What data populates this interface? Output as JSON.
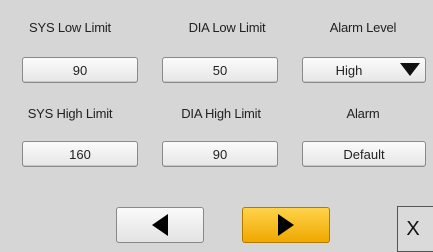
{
  "labels": {
    "sys_low": "SYS Low Limit",
    "dia_low": "DIA Low Limit",
    "alarm_level": "Alarm Level",
    "sys_high": "SYS High Limit",
    "dia_high": "DIA High Limit",
    "alarm": "Alarm"
  },
  "values": {
    "sys_low": "90",
    "dia_low": "50",
    "alarm_level": "High",
    "sys_high": "160",
    "dia_high": "90",
    "alarm": "Default"
  },
  "nav": {
    "prev_icon": "left-triangle",
    "next_icon": "right-triangle",
    "close_label": "X"
  },
  "colors": {
    "background": "#d6d6d6",
    "next_button": "#f5b800"
  }
}
